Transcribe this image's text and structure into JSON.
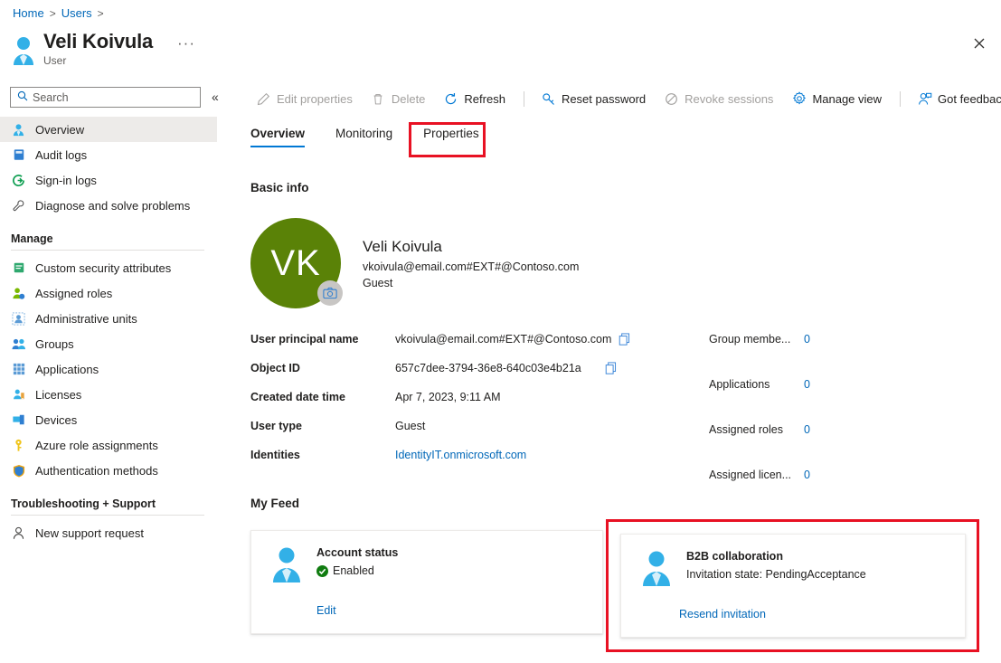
{
  "breadcrumb": {
    "items": [
      "Home",
      "Users"
    ],
    "separator": ">"
  },
  "header": {
    "title": "Veli Koivula",
    "subtitle": "User",
    "ellipsis": "···",
    "user_icon": "user-icon",
    "close_icon": "close-icon"
  },
  "search": {
    "placeholder": "Search",
    "value": "",
    "icon": "search-icon",
    "collapse_icon": "chevron-double-left-icon"
  },
  "sidebar": {
    "items": [
      {
        "label": "Overview",
        "icon": "user-icon",
        "selected": true
      },
      {
        "label": "Audit logs",
        "icon": "book-icon",
        "selected": false
      },
      {
        "label": "Sign-in logs",
        "icon": "sign-in-icon",
        "selected": false
      },
      {
        "label": "Diagnose and solve problems",
        "icon": "wrench-icon",
        "selected": false
      }
    ],
    "manage_group": "Manage",
    "manage_items": [
      {
        "label": "Custom security attributes",
        "icon": "attributes-icon"
      },
      {
        "label": "Assigned roles",
        "icon": "assigned-roles-icon"
      },
      {
        "label": "Administrative units",
        "icon": "administrative-units-icon"
      },
      {
        "label": "Groups",
        "icon": "groups-icon"
      },
      {
        "label": "Applications",
        "icon": "applications-grid-icon"
      },
      {
        "label": "Licenses",
        "icon": "license-icon"
      },
      {
        "label": "Devices",
        "icon": "devices-icon"
      },
      {
        "label": "Azure role assignments",
        "icon": "key-icon"
      },
      {
        "label": "Authentication methods",
        "icon": "shield-icon"
      }
    ],
    "support_group": "Troubleshooting + Support",
    "support_items": [
      {
        "label": "New support request",
        "icon": "support-person-icon"
      }
    ]
  },
  "commandbar": {
    "items": [
      {
        "label": "Edit properties",
        "icon": "pencil-icon",
        "disabled": true
      },
      {
        "label": "Delete",
        "icon": "trash-icon",
        "disabled": true
      },
      {
        "label": "Refresh",
        "icon": "refresh-icon",
        "disabled": false
      },
      {
        "label": "Reset password",
        "icon": "key-icon",
        "disabled": false
      },
      {
        "label": "Revoke sessions",
        "icon": "block-icon",
        "disabled": true
      },
      {
        "label": "Manage view",
        "icon": "gear-icon",
        "disabled": false
      },
      {
        "label": "Got feedback?",
        "icon": "feedback-person-icon",
        "disabled": false
      }
    ]
  },
  "tabs": [
    {
      "label": "Overview",
      "active": true
    },
    {
      "label": "Monitoring",
      "active": false
    },
    {
      "label": "Properties",
      "active": false,
      "highlighted": true
    }
  ],
  "main": {
    "basic_info_heading": "Basic info",
    "profile": {
      "initials": "VK",
      "name": "Veli Koivula",
      "upn": "vkoivula@email.com#EXT#@Contoso.com",
      "user_type": "Guest",
      "camera_icon": "camera-icon",
      "avatar_color": "#5a8207"
    },
    "fields": [
      {
        "label": "User principal name",
        "value": "vkoivula@email.com#EXT#@Contoso.com",
        "copy": true,
        "link": false
      },
      {
        "label": "Object ID",
        "value": "657c7dee-3794-36e8-640c03e4b21a",
        "copy": true,
        "link": false
      },
      {
        "label": "Created date time",
        "value": "Apr 7, 2023, 9:11 AM",
        "copy": false,
        "link": false
      },
      {
        "label": "User type",
        "value": "Guest",
        "copy": false,
        "link": false
      },
      {
        "label": "Identities",
        "value": "IdentityIT.onmicrosoft.com",
        "copy": false,
        "link": true
      }
    ],
    "stats": [
      {
        "label": "Group membe...",
        "value": "0"
      },
      {
        "label": "Applications",
        "value": "0"
      },
      {
        "label": "Assigned roles",
        "value": "0"
      },
      {
        "label": "Assigned licen...",
        "value": "0"
      }
    ],
    "my_feed_heading": "My Feed",
    "cards": [
      {
        "title": "Account status",
        "subtitle": "Enabled",
        "status_icon": "check-circle-icon",
        "link": "Edit",
        "icon": "user-icon"
      },
      {
        "title": "B2B collaboration",
        "subtitle": "Invitation state: PendingAcceptance",
        "status_icon": "",
        "link": "Resend invitation",
        "icon": "user-icon"
      }
    ]
  },
  "colors": {
    "accent": "#0078d4",
    "link": "#0067b8",
    "annotation": "#e81123",
    "success": "#107c10",
    "avatar": "#5a8207"
  }
}
